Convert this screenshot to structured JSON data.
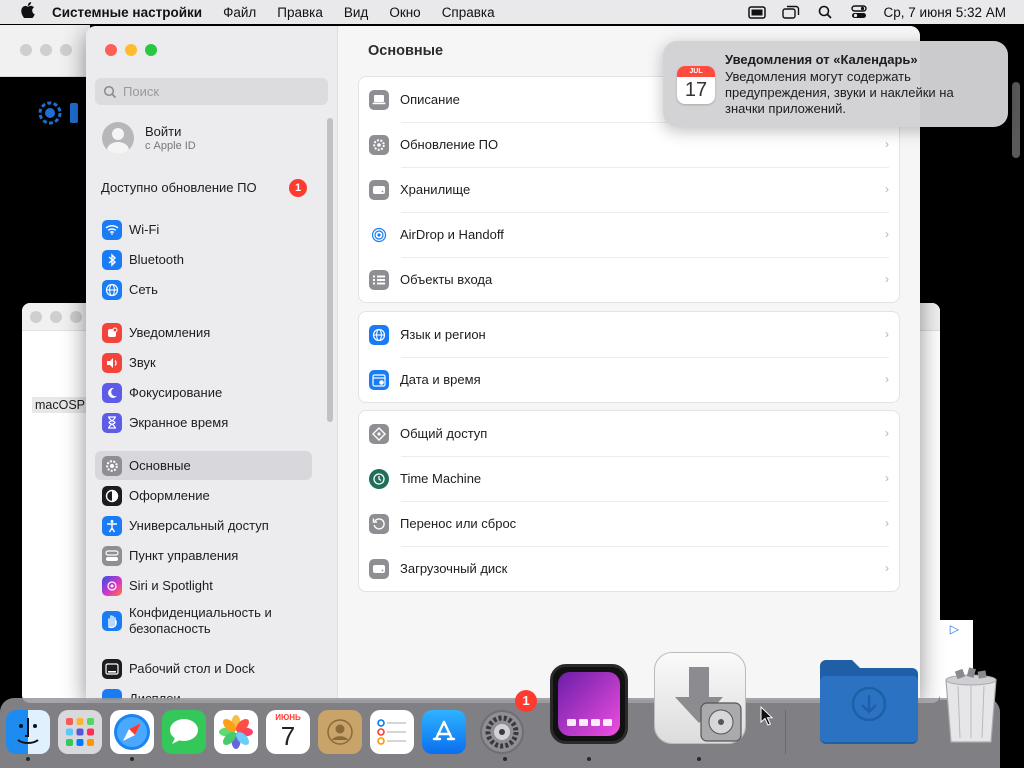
{
  "menubar": {
    "app": "Системные настройки",
    "items": [
      "Файл",
      "Правка",
      "Вид",
      "Окно",
      "Справка"
    ],
    "clock": "Ср, 7 июня  5:32 AM"
  },
  "background": {
    "label": "macOSP"
  },
  "sidebar": {
    "search_placeholder": "Поиск",
    "account_name": "Войти",
    "account_sub": "с Apple ID",
    "update_label": "Доступно обновление ПО",
    "update_badge": "1",
    "items": [
      {
        "label": "Wi-Fi",
        "icon": "wifi-icon",
        "color": "#1a7cf5"
      },
      {
        "label": "Bluetooth",
        "icon": "bluetooth-icon",
        "color": "#1a7cf5"
      },
      {
        "label": "Сеть",
        "icon": "globe-icon",
        "color": "#1a7cf5"
      },
      {
        "label": "Уведомления",
        "icon": "bell-icon",
        "color": "#f2443a"
      },
      {
        "label": "Звук",
        "icon": "speaker-icon",
        "color": "#f2443a"
      },
      {
        "label": "Фокусирование",
        "icon": "moon-icon",
        "color": "#5e5ce6"
      },
      {
        "label": "Экранное время",
        "icon": "hourglass-icon",
        "color": "#5e5ce6"
      },
      {
        "label": "Основные",
        "icon": "gear-icon",
        "color": "#8e8e93"
      },
      {
        "label": "Оформление",
        "icon": "appearance-icon",
        "color": "#1c1c1e"
      },
      {
        "label": "Универсальный доступ",
        "icon": "accessibility-icon",
        "color": "#1a7cf5"
      },
      {
        "label": "Пункт управления",
        "icon": "control-center-icon",
        "color": "#8e8e93"
      },
      {
        "label": "Siri и Spotlight",
        "icon": "siri-icon",
        "color": "#b03de6"
      },
      {
        "label": "Конфиденциальность и безопасность",
        "icon": "hand-icon",
        "color": "#1a7cf5"
      },
      {
        "label": "Рабочий стол и Dock",
        "icon": "dock-icon",
        "color": "#1c1c1e"
      },
      {
        "label": "Дисплеи",
        "icon": "display-icon",
        "color": "#1a7cf5"
      }
    ]
  },
  "main": {
    "title": "Основные",
    "groups": [
      [
        {
          "label": "Описание",
          "icon": "laptop-icon",
          "color": "#8e8e93"
        },
        {
          "label": "Обновление ПО",
          "icon": "gear-badge-icon",
          "color": "#8e8e93"
        },
        {
          "label": "Хранилище",
          "icon": "storage-icon",
          "color": "#8e8e93"
        },
        {
          "label": "AirDrop и Handoff",
          "icon": "airdrop-icon",
          "color": "#ffffff"
        },
        {
          "label": "Объекты входа",
          "icon": "list-icon",
          "color": "#8e8e93"
        }
      ],
      [
        {
          "label": "Язык и регион",
          "icon": "globe-icon",
          "color": "#1a7cf5"
        },
        {
          "label": "Дата и время",
          "icon": "calendar-clock-icon",
          "color": "#1a7cf5"
        }
      ],
      [
        {
          "label": "Общий доступ",
          "icon": "sharing-icon",
          "color": "#8e8e93"
        },
        {
          "label": "Time Machine",
          "icon": "time-machine-icon",
          "color": "#1f6f5c"
        },
        {
          "label": "Перенос или сброс",
          "icon": "reset-icon",
          "color": "#8e8e93"
        },
        {
          "label": "Загрузочный диск",
          "icon": "disk-icon",
          "color": "#8e8e93"
        }
      ]
    ]
  },
  "notification": {
    "title": "Уведомления от «Календарь»",
    "body": "Уведомления могут содержать предупреждения, звуки и наклейки на значки приложений.",
    "cal_month": "JUL",
    "cal_day": "17"
  },
  "dock": {
    "calendar_month": "ИЮНЬ",
    "calendar_day": "7",
    "settings_badge": "1"
  }
}
